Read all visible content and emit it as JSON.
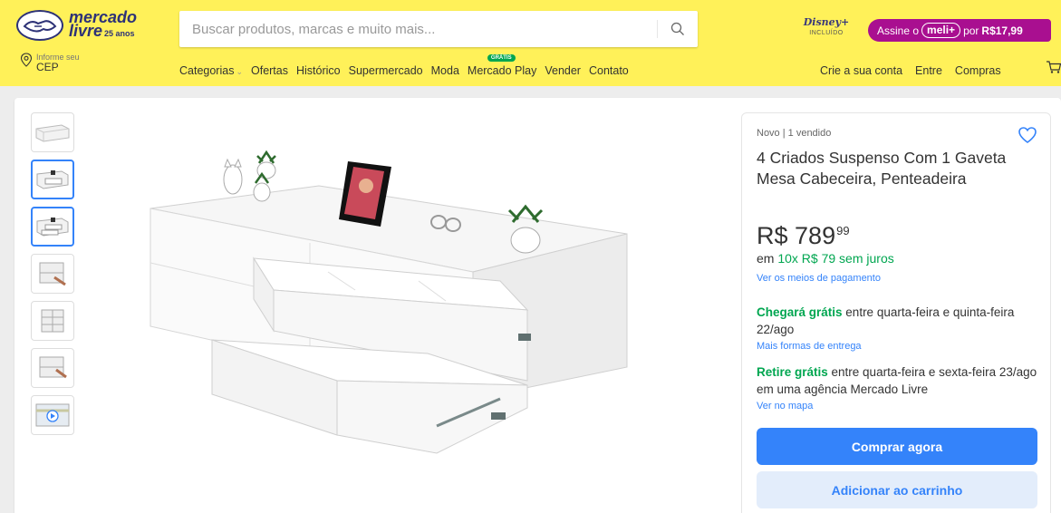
{
  "header": {
    "logo_line1": "mercado",
    "logo_line2": "livre",
    "logo_anniv": "25 anos",
    "search_placeholder": "Buscar produtos, marcas e muito mais...",
    "disney_logo": "Disney+",
    "disney_sub": "INCLUÍDO",
    "meli_pre": "Assine o",
    "meli_brand": "meli+",
    "meli_mid": "por",
    "meli_price": "R$17,99",
    "cep_small": "Informe seu",
    "cep_big": "CEP"
  },
  "nav": {
    "categorias": "Categorias",
    "ofertas": "Ofertas",
    "historico": "Histórico",
    "supermercado": "Supermercado",
    "moda": "Moda",
    "mercado_play": "Mercado Play",
    "gratis_badge": "GRÁTIS",
    "vender": "Vender",
    "contato": "Contato",
    "crie_conta": "Crie a sua conta",
    "entre": "Entre",
    "compras": "Compras"
  },
  "product": {
    "condition": "Novo | 1 vendido",
    "title": "4 Criados Suspenso Com 1 Gaveta Mesa Cabeceira, Penteadeira",
    "price_currency": "R$",
    "price_int": "789",
    "price_cents": "99",
    "installments_pre": "em",
    "installments_green": "10x R$ 79 sem juros",
    "payment_link": "Ver os meios de pagamento",
    "delivery_bold": "Chegará grátis",
    "delivery_text": " entre quarta-feira e quinta-feira 22/ago",
    "delivery_link": "Mais formas de entrega",
    "pickup_bold": "Retire grátis",
    "pickup_text": " entre quarta-feira e sexta-feira 23/ago em uma agência Mercado Livre",
    "pickup_link": "Ver no mapa",
    "buy_now": "Comprar agora",
    "add_cart": "Adicionar ao carrinho"
  },
  "colors": {
    "header_bg": "#fff159",
    "accent": "#3483fa",
    "green": "#00a650",
    "meli_purple": "#a90f90"
  }
}
